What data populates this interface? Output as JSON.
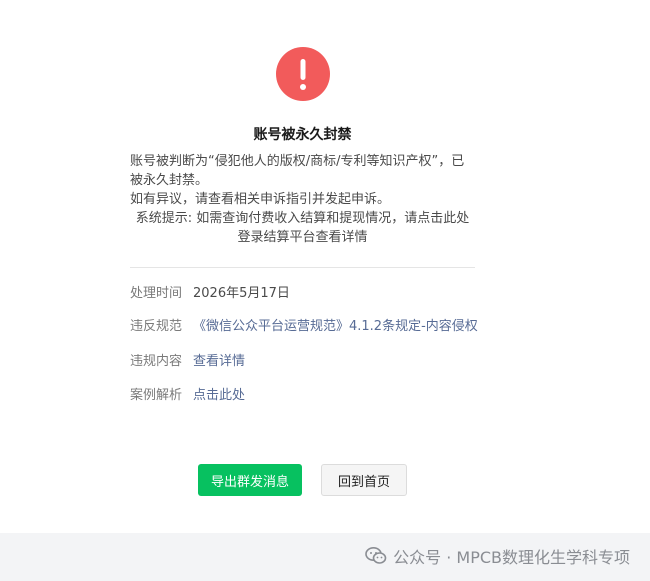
{
  "colors": {
    "alert": "#f25b5b",
    "primary": "#07c160",
    "link": "#576b95"
  },
  "icons": {
    "alert": "exclamation-circle-icon",
    "watermark": "wechat-icon"
  },
  "header": {
    "title": "账号被永久封禁"
  },
  "description": {
    "line1": "账号被判断为“侵犯他人的版权/商标/专利等知识产权”，已被永久封禁。",
    "line2": "如有异议，请查看相关申诉指引并发起申诉。",
    "line3": "系统提示: 如需查询付费收入结算和提现情况，请点击此处登录结算平台查看详情"
  },
  "details": [
    {
      "label": "处理时间",
      "value": "2026年5月17日"
    },
    {
      "label": "违反规范",
      "value": "《微信公众平台运营规范》4.1.2条规定-内容侵权"
    },
    {
      "label": "违规内容",
      "value": "查看详情"
    },
    {
      "label": "案例解析",
      "value": "点击此处"
    }
  ],
  "actions": {
    "export_label": "导出群发消息",
    "home_label": "回到首页"
  },
  "watermark": {
    "text": "公众号 · MPCB数理化生学科专项"
  }
}
